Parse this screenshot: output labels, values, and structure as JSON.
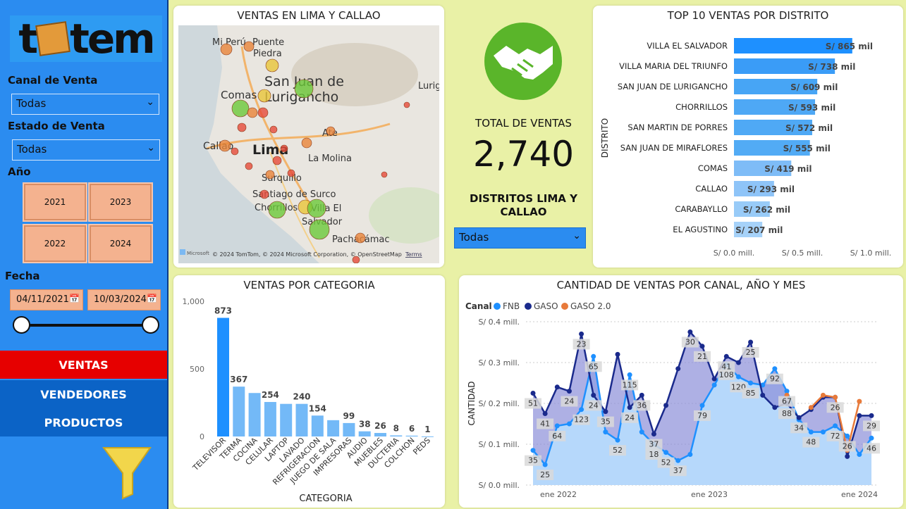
{
  "logo": {
    "text_left": "t",
    "text_right": "tem"
  },
  "filters": {
    "canal_label": "Canal de Venta",
    "canal_value": "Todas",
    "estado_label": "Estado de Venta",
    "estado_value": "Todas",
    "anio_label": "Año",
    "years": [
      "2021",
      "2023",
      "2022",
      "2024"
    ],
    "fecha_label": "Fecha",
    "date_from": "04/11/2021",
    "date_to": "10/03/2024"
  },
  "nav": {
    "ventas": "VENTAS",
    "vendedores": "VENDEDORES",
    "productos": "PRODUCTOS"
  },
  "map": {
    "title": "VENTAS EN LIMA Y CALLAO",
    "places": [
      "Mi Perú",
      "Puente",
      "Piedra",
      "San Juan de",
      "Lurigancho",
      "Comas",
      "Callao",
      "Lima",
      "Ate",
      "La Molina",
      "Surquillo",
      "Santiago de Surco",
      "Chorrillos",
      "Villa El",
      "Salvador",
      "Pachacámac",
      "Lurig"
    ],
    "attribution": "© 2024 TomTom, © 2024 Microsoft Corporation, © OpenStreetMap",
    "terms": "Terms",
    "brand": "Microsoft",
    "colors": {
      "green": "#6cc93a",
      "yellow": "#e8c53a",
      "orange": "#e8853a",
      "red": "#e64b3a"
    }
  },
  "kpi": {
    "label": "TOTAL DE VENTAS",
    "value": "2,740",
    "distritos_label": "DISTRITOS LIMA Y CALLAO",
    "distritos_value": "Todas",
    "icon": "handshake-icon"
  },
  "top10": {
    "title": "TOP 10 VENTAS POR DISTRITO",
    "ylabel": "DISTRITO",
    "xticks": [
      "S/ 0.0 mill.",
      "S/ 0.5 mill.",
      "S/ 1.0 mill."
    ]
  },
  "categoria": {
    "title": "VENTAS POR CATEGORIA",
    "xlabel": "CATEGORIA",
    "yticks": [
      "1,000",
      "500",
      "0"
    ]
  },
  "canal": {
    "title": "CANTIDAD DE VENTAS POR CANAL, AÑO Y MES",
    "legend_title": "Canal",
    "ylabel": "CANTIDAD",
    "yticks": [
      "S/ 0.4 mill.",
      "S/ 0.3 mill.",
      "S/ 0.2 mill.",
      "S/ 0.1 mill.",
      "S/ 0.0 mill."
    ],
    "xticks": [
      "ene 2022",
      "ene 2023",
      "ene 2024"
    ]
  },
  "chart_data": [
    {
      "type": "bar",
      "title": "TOP 10 VENTAS POR DISTRITO",
      "ylabel": "DISTRITO",
      "orientation": "horizontal",
      "categories": [
        "VILLA EL SALVADOR",
        "VILLA MARIA DEL TRIUNFO",
        "SAN JUAN DE LURIGANCHO",
        "CHORRILLOS",
        "SAN MARTIN DE PORRES",
        "SAN JUAN DE MIRAFLORES",
        "COMAS",
        "CALLAO",
        "CARABAYLLO",
        "EL AGUSTINO"
      ],
      "values": [
        865,
        738,
        609,
        593,
        572,
        555,
        419,
        293,
        262,
        207
      ],
      "labels": [
        "S/ 865 mil",
        "S/ 738 mil",
        "S/ 609 mil",
        "S/ 593 mil",
        "S/ 572 mil",
        "S/ 555 mil",
        "S/ 419 mil",
        "S/ 293 mil",
        "S/ 262 mil",
        "S/ 207 mil"
      ],
      "xlim": [
        0,
        1000
      ]
    },
    {
      "type": "bar",
      "title": "VENTAS POR CATEGORIA",
      "xlabel": "CATEGORIA",
      "categories": [
        "TELEVISOR",
        "TERMA",
        "COCINA",
        "CELULAR",
        "LAPTOP",
        "LAVADO",
        "REFRIGERACION",
        "JUEGO DE SALA",
        "IMPRESORAS",
        "AUDIO",
        "MUEBLES",
        "DUCTERIA",
        "COLCHON",
        "PEDS"
      ],
      "values": [
        873,
        367,
        320,
        254,
        240,
        240,
        154,
        120,
        99,
        38,
        26,
        8,
        6,
        1
      ],
      "labels": [
        "873",
        "367",
        "",
        "254",
        "",
        "240",
        "154",
        "",
        "99",
        "38",
        "26",
        "8",
        "6",
        "1"
      ],
      "ylim": [
        0,
        1000
      ]
    },
    {
      "type": "area",
      "title": "CANTIDAD DE VENTAS POR CANAL, AÑO Y MES",
      "ylabel": "CANTIDAD",
      "ylim": [
        0,
        0.4
      ],
      "x": [
        "2021-11",
        "2021-12",
        "2022-01",
        "2022-02",
        "2022-03",
        "2022-04",
        "2022-05",
        "2022-06",
        "2022-07",
        "2022-08",
        "2022-09",
        "2022-10",
        "2022-11",
        "2022-12",
        "2023-01",
        "2023-02",
        "2023-03",
        "2023-04",
        "2023-05",
        "2023-06",
        "2023-07",
        "2023-08",
        "2023-09",
        "2023-10",
        "2023-11",
        "2023-12",
        "2024-01",
        "2024-02",
        "2024-03"
      ],
      "series": [
        {
          "name": "FNB",
          "color": "#1e90ff",
          "values": [
            0.085,
            0.05,
            0.145,
            0.15,
            0.185,
            0.315,
            0.13,
            0.11,
            0.27,
            0.13,
            0.1,
            0.08,
            0.06,
            0.075,
            0.195,
            0.245,
            0.295,
            0.265,
            0.25,
            0.245,
            0.285,
            0.23,
            0.16,
            0.13,
            0.13,
            0.145,
            0.12,
            0.075,
            0.115
          ]
        },
        {
          "name": "GASO",
          "color": "#1a2a8c",
          "values": [
            0.225,
            0.175,
            0.24,
            0.23,
            0.37,
            0.22,
            0.18,
            0.32,
            0.19,
            0.22,
            0.125,
            0.195,
            0.285,
            0.375,
            0.34,
            0.26,
            0.315,
            0.3,
            0.35,
            0.22,
            0.19,
            0.2,
            0.165,
            0.185,
            0.215,
            0.215,
            0.07,
            0.17,
            0.17
          ]
        },
        {
          "name": "GASO 2.0",
          "color": "#e87a3a",
          "values": [
            null,
            null,
            null,
            null,
            null,
            null,
            null,
            null,
            null,
            null,
            null,
            null,
            null,
            null,
            null,
            null,
            null,
            null,
            null,
            null,
            null,
            0.22,
            null,
            0.19,
            0.22,
            0.215,
            0.085,
            0.205,
            null
          ]
        }
      ],
      "data_labels": {
        "FNB": [
          "35",
          "25",
          "64",
          "",
          "123",
          "65",
          "52",
          "115",
          "18",
          "52",
          "37",
          "79",
          "108",
          "120",
          "85",
          "92",
          "67",
          "48",
          "72",
          "26",
          "46"
        ],
        "GASO": [
          "51",
          "41",
          "24",
          "23",
          "24",
          "35",
          "24",
          "36",
          "37",
          "30",
          "21",
          "41",
          "25",
          "88",
          "34",
          "26",
          "29"
        ]
      }
    }
  ]
}
